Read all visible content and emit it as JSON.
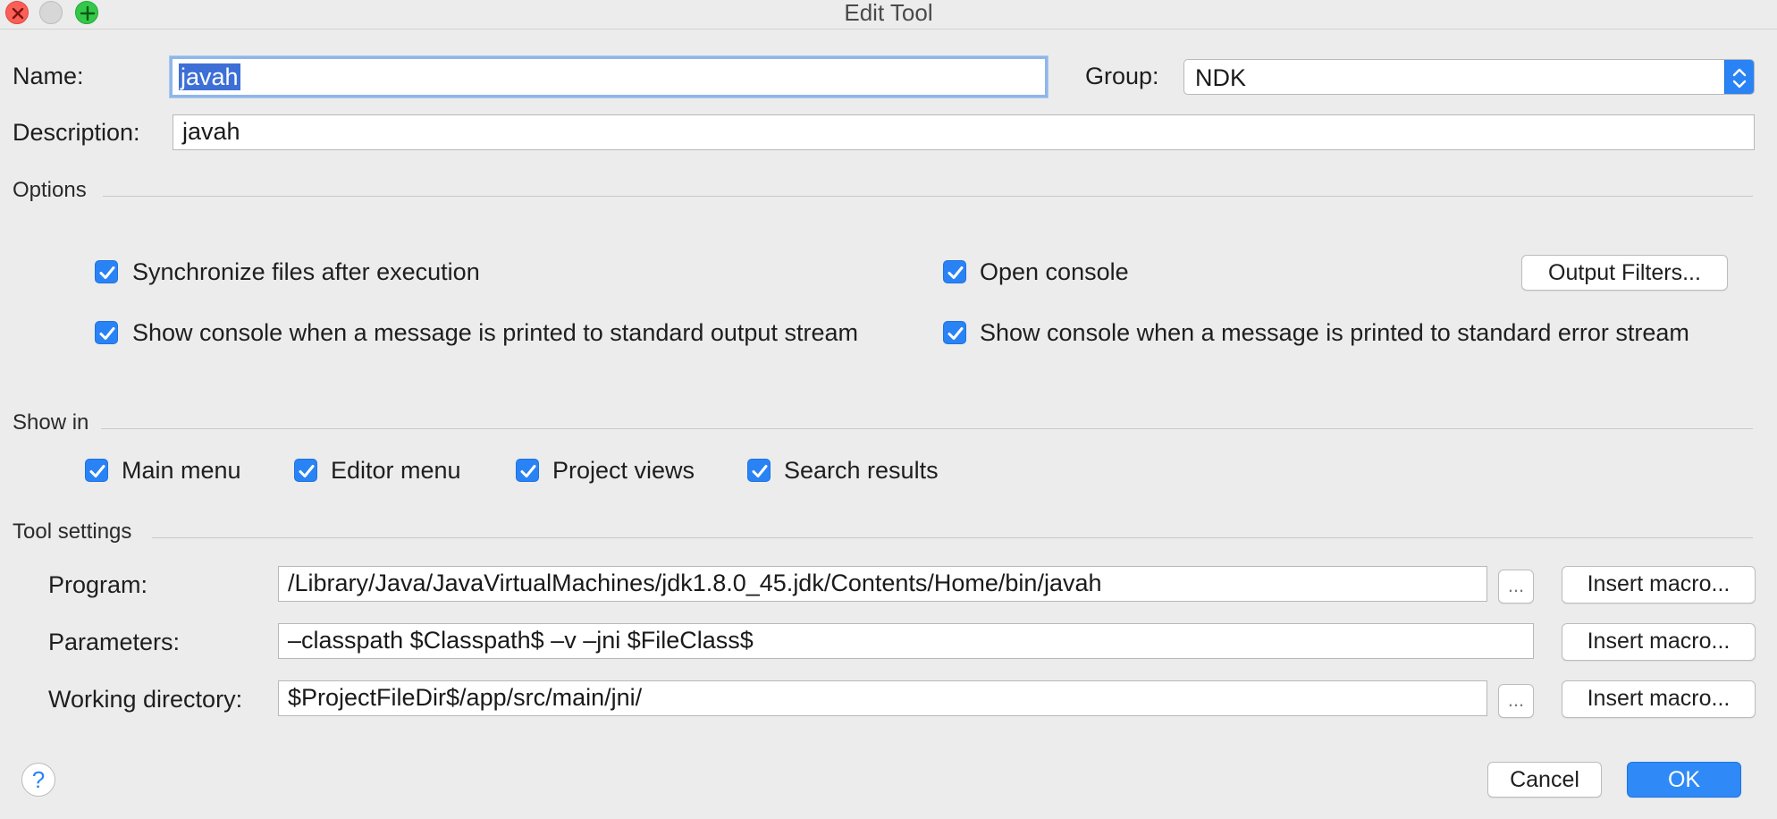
{
  "window": {
    "title": "Edit Tool"
  },
  "form": {
    "name_label": "Name:",
    "name_value": "javah",
    "group_label": "Group:",
    "group_value": "NDK",
    "description_label": "Description:",
    "description_value": "javah"
  },
  "options": {
    "section_title": "Options",
    "sync_files": {
      "label": "Synchronize files after execution",
      "checked": true
    },
    "open_console": {
      "label": "Open console",
      "checked": true
    },
    "output_filters_label": "Output Filters...",
    "show_stdout": {
      "label": "Show console when a message is printed to standard output stream",
      "checked": true
    },
    "show_stderr": {
      "label": "Show console when a message is printed to standard error stream",
      "checked": true
    }
  },
  "show_in": {
    "section_title": "Show in",
    "items": [
      {
        "label": "Main menu",
        "checked": true
      },
      {
        "label": "Editor menu",
        "checked": true
      },
      {
        "label": "Project views",
        "checked": true
      },
      {
        "label": "Search results",
        "checked": true
      }
    ]
  },
  "tool_settings": {
    "section_title": "Tool settings",
    "program_label": "Program:",
    "program_value": "/Library/Java/JavaVirtualMachines/jdk1.8.0_45.jdk/Contents/Home/bin/javah",
    "parameters_label": "Parameters:",
    "parameters_value": "–classpath $Classpath$ –v –jni $FileClass$",
    "working_dir_label": "Working directory:",
    "working_dir_value": "$ProjectFileDir$/app/src/main/jni/",
    "browse_label": "...",
    "insert_macro_label": "Insert macro..."
  },
  "footer": {
    "help_label": "?",
    "cancel_label": "Cancel",
    "ok_label": "OK"
  },
  "colors": {
    "accent": "#2a83f5",
    "background": "#ececec",
    "selection": "#3d6fd6"
  },
  "icons": [
    "close-window-icon",
    "minimize-window-icon",
    "zoom-window-icon",
    "combo-arrows-icon",
    "checkmark-icon",
    "help-icon"
  ]
}
